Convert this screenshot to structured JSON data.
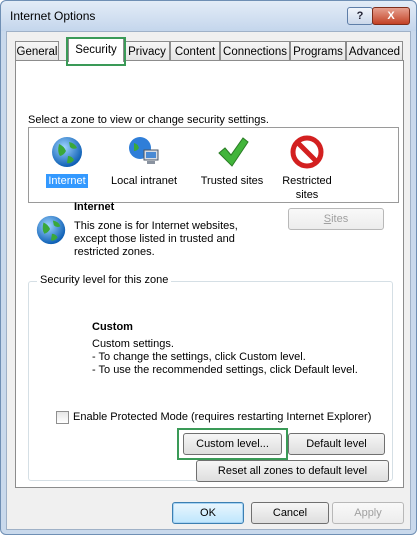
{
  "window": {
    "title": "Internet Options",
    "help_label": "?",
    "close_label": "X"
  },
  "tabs": [
    "General",
    "Security",
    "Privacy",
    "Content",
    "Connections",
    "Programs",
    "Advanced"
  ],
  "security": {
    "instruction": "Select a zone to view or change security settings.",
    "zones": [
      {
        "label": "Internet",
        "icon": "globe-icon",
        "selected": true
      },
      {
        "label": "Local intranet",
        "icon": "intranet-icon",
        "selected": false
      },
      {
        "label": "Trusted sites",
        "icon": "checkmark-icon",
        "selected": false
      },
      {
        "label_line1": "Restricted",
        "label_line2": "sites",
        "icon": "restricted-icon",
        "selected": false
      }
    ],
    "selected_zone": {
      "title": "Internet",
      "desc_line1": "This zone is for Internet websites,",
      "desc_line2": "except those listed in trusted and",
      "desc_line3": "restricted zones."
    },
    "sites_button": {
      "label": "Sites",
      "accel": "S",
      "rest": "ites",
      "enabled": false
    },
    "level_group": {
      "title": "Security level for this zone",
      "level_name": "Custom",
      "line1": "Custom settings.",
      "line2": "- To change the settings, click Custom level.",
      "line3": "- To use the recommended settings, click Default level."
    },
    "protected_mode": {
      "label": "Enable Protected Mode (requires restarting Internet Explorer)",
      "checked": false
    },
    "custom_level_button": "Custom level...",
    "default_level_button": "Default level",
    "reset_all_button": "Reset all zones to default level"
  },
  "footer": {
    "ok": "OK",
    "cancel": "Cancel",
    "apply": "Apply"
  },
  "colors": {
    "highlight": "#3a9a57",
    "selection": "#3399ff"
  }
}
